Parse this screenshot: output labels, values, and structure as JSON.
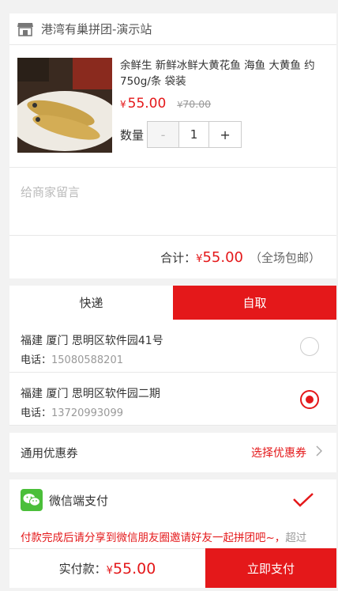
{
  "shop": {
    "name": "港湾有巢拼团-演示站",
    "icon": "store-icon"
  },
  "product": {
    "title": "余鲜生 新鲜冰鲜大黄花鱼 海鱼 大黄鱼 约750g/条 袋装",
    "currency": "¥",
    "price": "55.00",
    "original_price": "70.00",
    "qty_label": "数量",
    "qty": "1",
    "minus": "-",
    "plus": "+"
  },
  "message": {
    "placeholder": "给商家留言"
  },
  "total": {
    "label": "合计：",
    "currency": "¥",
    "amount": "55.00",
    "note": "（全场包邮）"
  },
  "delivery": {
    "tabs": [
      {
        "label": "快递",
        "active": false
      },
      {
        "label": "自取",
        "active": true
      }
    ],
    "addresses": [
      {
        "address": "福建 厦门 思明区软件园41号",
        "phone_label": "电话：",
        "phone": "15080588201",
        "selected": false
      },
      {
        "address": "福建 厦门 思明区软件园二期",
        "phone_label": "电话：",
        "phone": "13720993099",
        "selected": true
      }
    ]
  },
  "coupon": {
    "label": "通用优惠券",
    "action": "选择优惠券"
  },
  "payment": {
    "label": "微信端支付",
    "tip": "付款完成后请分享到微信朋友圈邀请好友一起拼团吧~，",
    "tip_rest": "超过"
  },
  "footer": {
    "label": "实付款：",
    "currency": "¥",
    "amount": "55.00",
    "button": "立即支付"
  },
  "colors": {
    "accent": "#e4181a",
    "wechat": "#4bbf3a"
  }
}
